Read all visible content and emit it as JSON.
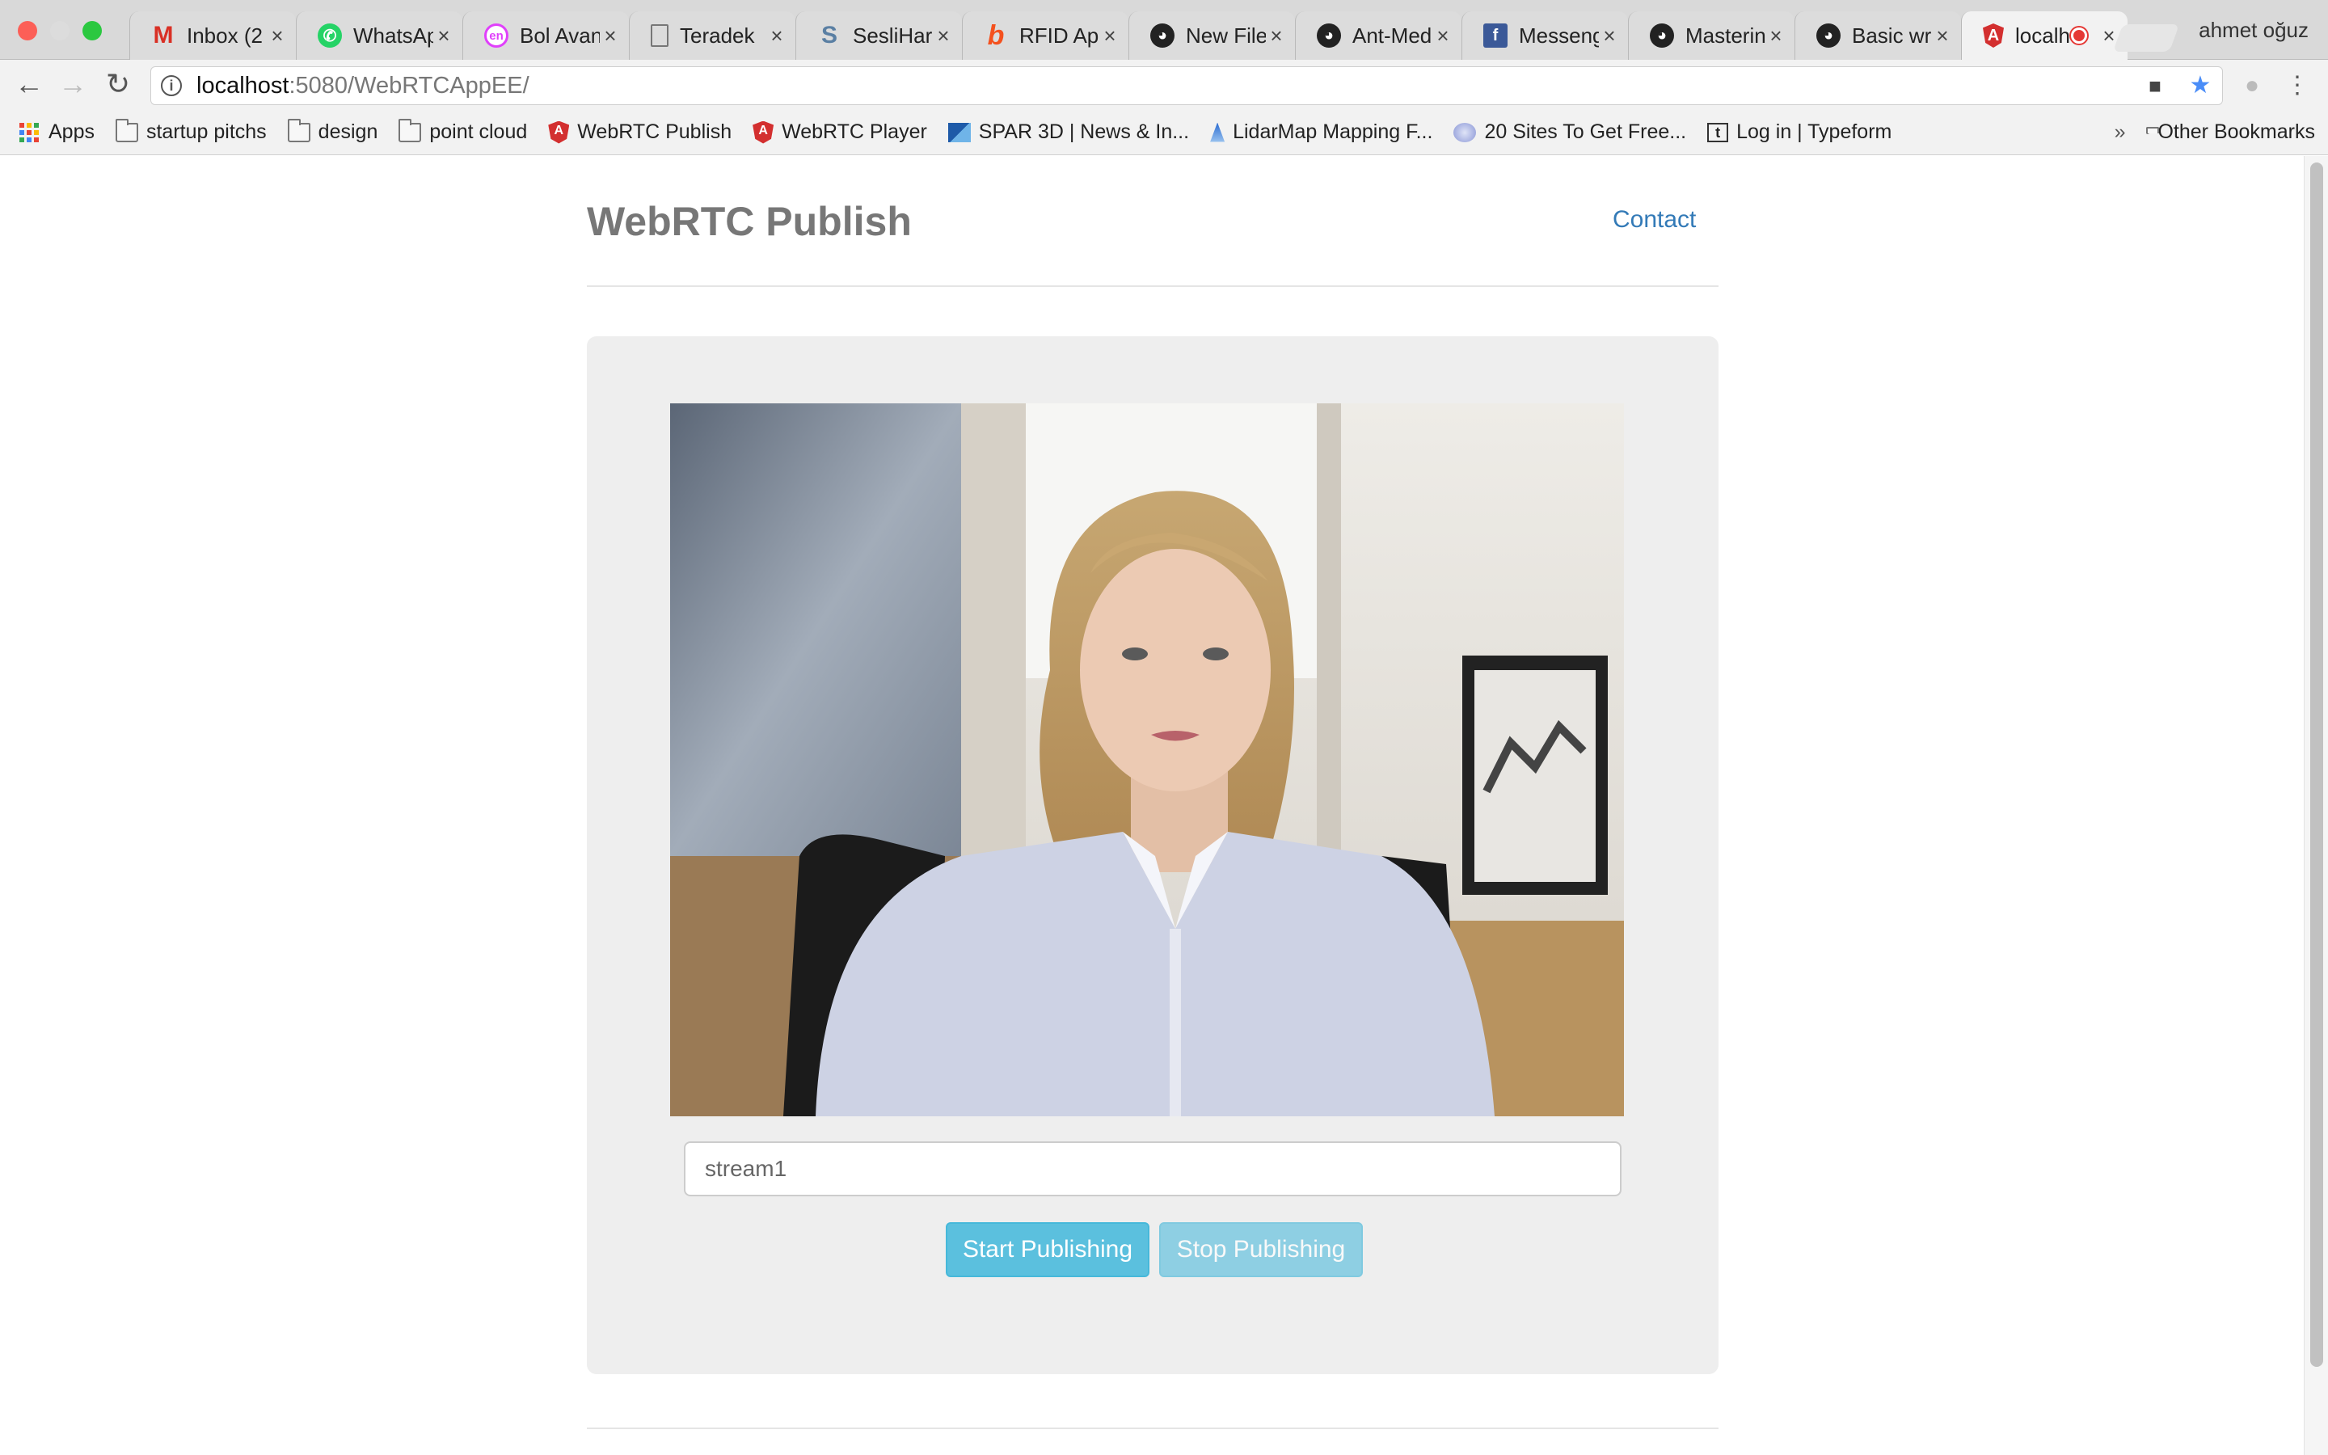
{
  "browser": {
    "tabs": [
      {
        "label": "Inbox (2",
        "icon": "gmail-icon"
      },
      {
        "label": "WhatsAp",
        "icon": "whatsapp-icon"
      },
      {
        "label": "Bol Avan",
        "icon": "en-icon"
      },
      {
        "label": "Teradek",
        "icon": "page-icon"
      },
      {
        "label": "SesliHar",
        "icon": "s-icon"
      },
      {
        "label": "RFID App",
        "icon": "b-icon"
      },
      {
        "label": "New File",
        "icon": "github-icon"
      },
      {
        "label": "Ant-Med",
        "icon": "github-icon"
      },
      {
        "label": "Messeng",
        "icon": "facebook-icon"
      },
      {
        "label": "Masterin",
        "icon": "github-icon"
      },
      {
        "label": "Basic wr",
        "icon": "github-icon"
      },
      {
        "label": "localh",
        "icon": "angular-icon",
        "active": true,
        "recording": true
      }
    ],
    "close_glyph": "×",
    "profile_name": "ahmet oğuz",
    "url_host": "localhost",
    "url_path": ":5080/WebRTCAppEE/",
    "bookmarks": [
      {
        "label": "Apps",
        "icon": "apps-icon"
      },
      {
        "label": "startup pitchs",
        "icon": "folder-icon"
      },
      {
        "label": "design",
        "icon": "folder-icon"
      },
      {
        "label": "point cloud",
        "icon": "folder-icon"
      },
      {
        "label": "WebRTC Publish",
        "icon": "angular-icon"
      },
      {
        "label": "WebRTC Player",
        "icon": "angular-icon"
      },
      {
        "label": "SPAR 3D | News & In...",
        "icon": "spar-icon"
      },
      {
        "label": "LidarMap Mapping F...",
        "icon": "lidar-icon"
      },
      {
        "label": "20 Sites To Get Free...",
        "icon": "globe-icon"
      },
      {
        "label": "Log in | Typeform",
        "icon": "typeform-icon"
      }
    ],
    "overflow_glyph": "»",
    "other_bookmarks": "Other Bookmarks"
  },
  "page": {
    "brand": "WebRTC Publish",
    "contact_link": "Contact",
    "stream_name_value": "stream1",
    "start_button": "Start Publishing",
    "stop_button": "Stop Publishing"
  },
  "colors": {
    "brand_text": "#777777",
    "link": "#337ab7",
    "button": "#5bc0de",
    "panel": "#eeeeee"
  }
}
